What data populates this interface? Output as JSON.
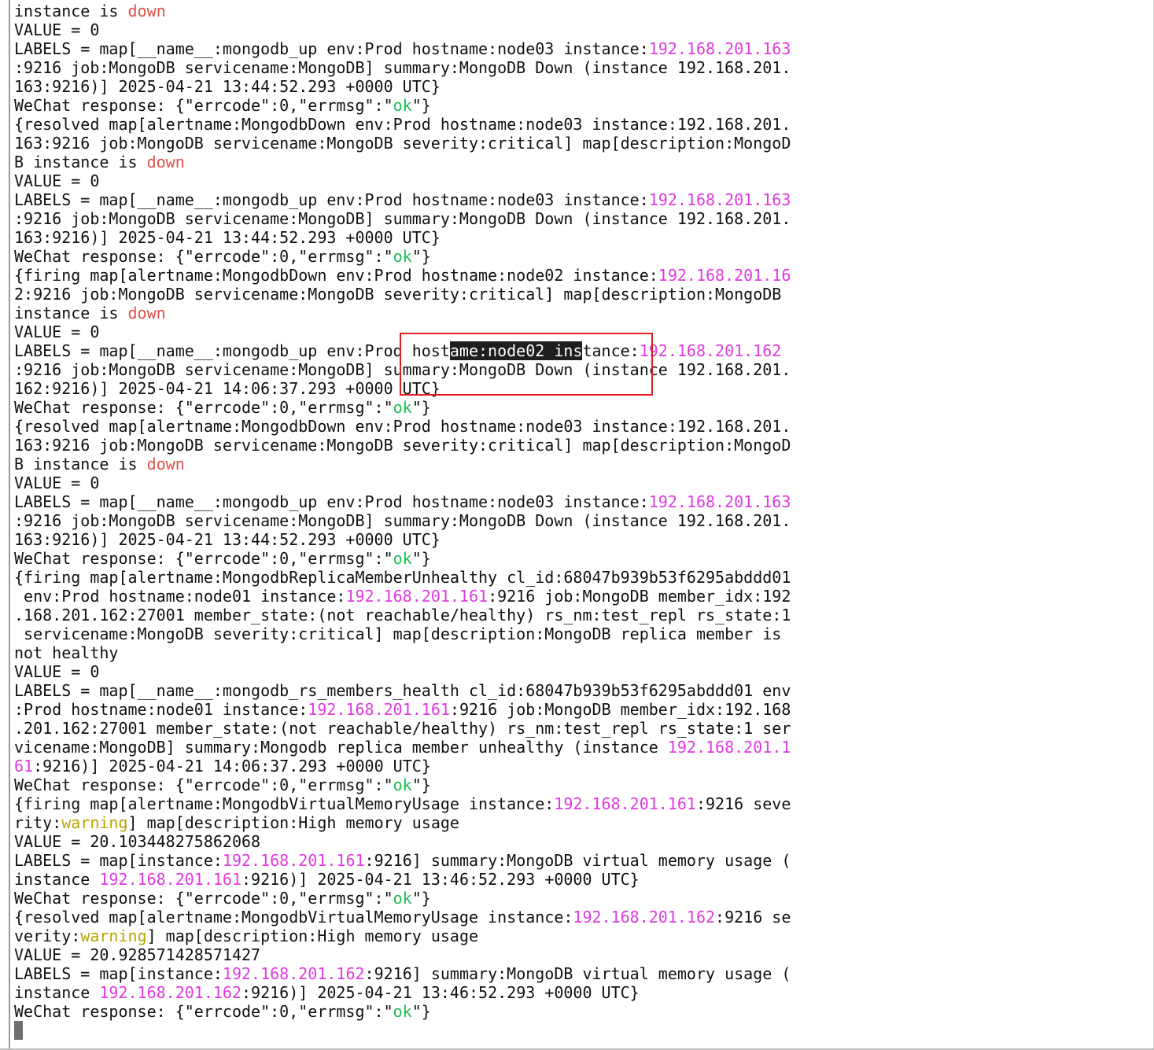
{
  "terminal": {
    "lines": [
      [
        {
          "t": "instance is ",
          "c": "default"
        },
        {
          "t": "down",
          "c": "red"
        }
      ],
      [
        {
          "t": "VALUE = 0",
          "c": "default"
        }
      ],
      [
        {
          "t": "LABELS = map[__name__:mongodb_up env:Prod hostname:node03 instance:",
          "c": "default"
        },
        {
          "t": "192.168.201.163",
          "c": "magenta"
        }
      ],
      [
        {
          "t": ":9216 job:MongoDB servicename:MongoDB] summary:MongoDB Down (instance 192.168.201.",
          "c": "default"
        }
      ],
      [
        {
          "t": "163:9216)] 2025-04-21 13:44:52.293 +0000 UTC}",
          "c": "default"
        }
      ],
      [
        {
          "t": "WeChat response: {\"errcode\":0,\"errmsg\":\"",
          "c": "default"
        },
        {
          "t": "ok",
          "c": "green"
        },
        {
          "t": "\"}",
          "c": "default"
        }
      ],
      [
        {
          "t": "{resolved map[alertname:MongodbDown env:Prod hostname:node03 instance:192.168.201.",
          "c": "default"
        }
      ],
      [
        {
          "t": "163:9216 job:MongoDB servicename:MongoDB severity:critical] map[description:MongoD",
          "c": "default"
        }
      ],
      [
        {
          "t": "B instance is ",
          "c": "default"
        },
        {
          "t": "down",
          "c": "red"
        }
      ],
      [
        {
          "t": "VALUE = 0",
          "c": "default"
        }
      ],
      [
        {
          "t": "LABELS = map[__name__:mongodb_up env:Prod hostname:node03 instance:",
          "c": "default"
        },
        {
          "t": "192.168.201.163",
          "c": "magenta"
        }
      ],
      [
        {
          "t": ":9216 job:MongoDB servicename:MongoDB] summary:MongoDB Down (instance 192.168.201.",
          "c": "default"
        }
      ],
      [
        {
          "t": "163:9216)] 2025-04-21 13:44:52.293 +0000 UTC}",
          "c": "default"
        }
      ],
      [
        {
          "t": "WeChat response: {\"errcode\":0,\"errmsg\":\"",
          "c": "default"
        },
        {
          "t": "ok",
          "c": "green"
        },
        {
          "t": "\"}",
          "c": "default"
        }
      ],
      [
        {
          "t": "{firing map[alertname:MongodbDown env:Prod hostname:node02 instance:",
          "c": "default"
        },
        {
          "t": "192.168.201.16",
          "c": "magenta"
        }
      ],
      [
        {
          "t": "2:9216 job:MongoDB servicename:MongoDB severity:critical] map[description:MongoDB",
          "c": "default"
        }
      ],
      [
        {
          "t": "instance is ",
          "c": "default"
        },
        {
          "t": "down",
          "c": "red"
        }
      ],
      [
        {
          "t": "VALUE = 0",
          "c": "default"
        }
      ],
      [
        {
          "t": "LABELS = map[__name__:mongodb_up env:Prod host",
          "c": "default"
        },
        {
          "t": "ame:node02 ins",
          "c": "selected"
        },
        {
          "t": "tance:",
          "c": "default"
        },
        {
          "t": "192.168.201.162",
          "c": "magenta"
        }
      ],
      [
        {
          "t": ":9216 job:MongoDB servicename:MongoDB] summary:MongoDB Down (instance 192.168.201.",
          "c": "default"
        }
      ],
      [
        {
          "t": "162:9216)] 2025-04-21 14:06:37.293 +0000 UTC}",
          "c": "default"
        }
      ],
      [
        {
          "t": "WeChat response: {\"errcode\":0,\"errmsg\":\"",
          "c": "default"
        },
        {
          "t": "ok",
          "c": "green"
        },
        {
          "t": "\"}",
          "c": "default"
        }
      ],
      [
        {
          "t": "{resolved map[alertname:MongodbDown env:Prod hostname:node03 instance:192.168.201.",
          "c": "default"
        }
      ],
      [
        {
          "t": "163:9216 job:MongoDB servicename:MongoDB severity:critical] map[description:MongoD",
          "c": "default"
        }
      ],
      [
        {
          "t": "B instance is ",
          "c": "default"
        },
        {
          "t": "down",
          "c": "red"
        }
      ],
      [
        {
          "t": "VALUE = 0",
          "c": "default"
        }
      ],
      [
        {
          "t": "LABELS = map[__name__:mongodb_up env:Prod hostname:node03 instance:",
          "c": "default"
        },
        {
          "t": "192.168.201.163",
          "c": "magenta"
        }
      ],
      [
        {
          "t": ":9216 job:MongoDB servicename:MongoDB] summary:MongoDB Down (instance 192.168.201.",
          "c": "default"
        }
      ],
      [
        {
          "t": "163:9216)] 2025-04-21 13:44:52.293 +0000 UTC}",
          "c": "default"
        }
      ],
      [
        {
          "t": "WeChat response: {\"errcode\":0,\"errmsg\":\"",
          "c": "default"
        },
        {
          "t": "ok",
          "c": "green"
        },
        {
          "t": "\"}",
          "c": "default"
        }
      ],
      [
        {
          "t": "{firing map[alertname:MongodbReplicaMemberUnhealthy cl_id:68047b939b53f6295abddd01",
          "c": "default"
        }
      ],
      [
        {
          "t": " env:Prod hostname:node01 instance:",
          "c": "default"
        },
        {
          "t": "192.168.201.161",
          "c": "magenta"
        },
        {
          "t": ":9216 job:MongoDB member_idx:192",
          "c": "default"
        }
      ],
      [
        {
          "t": ".168.201.162:27001 member_state:(not reachable/healthy) rs_nm:test_repl rs_state:1",
          "c": "default"
        }
      ],
      [
        {
          "t": " servicename:MongoDB severity:critical] map[description:MongoDB replica member is",
          "c": "default"
        }
      ],
      [
        {
          "t": "not healthy",
          "c": "default"
        }
      ],
      [
        {
          "t": "VALUE = 0",
          "c": "default"
        }
      ],
      [
        {
          "t": "LABELS = map[__name__:mongodb_rs_members_health cl_id:68047b939b53f6295abddd01 env",
          "c": "default"
        }
      ],
      [
        {
          "t": ":Prod hostname:node01 instance:",
          "c": "default"
        },
        {
          "t": "192.168.201.161",
          "c": "magenta"
        },
        {
          "t": ":9216 job:MongoDB member_idx:192.168",
          "c": "default"
        }
      ],
      [
        {
          "t": ".201.162:27001 member_state:(not reachable/healthy) rs_nm:test_repl rs_state:1 ser",
          "c": "default"
        }
      ],
      [
        {
          "t": "vicename:MongoDB] summary:Mongodb replica member unhealthy (instance ",
          "c": "default"
        },
        {
          "t": "192.168.201.1",
          "c": "magenta"
        }
      ],
      [
        {
          "t": "61",
          "c": "magenta"
        },
        {
          "t": ":9216)] 2025-04-21 14:06:37.293 +0000 UTC}",
          "c": "default"
        }
      ],
      [
        {
          "t": "WeChat response: {\"errcode\":0,\"errmsg\":\"",
          "c": "default"
        },
        {
          "t": "ok",
          "c": "green"
        },
        {
          "t": "\"}",
          "c": "default"
        }
      ],
      [
        {
          "t": "{firing map[alertname:MongodbVirtualMemoryUsage instance:",
          "c": "default"
        },
        {
          "t": "192.168.201.161",
          "c": "magenta"
        },
        {
          "t": ":9216 seve",
          "c": "default"
        }
      ],
      [
        {
          "t": "rity:",
          "c": "default"
        },
        {
          "t": "warning",
          "c": "yellow"
        },
        {
          "t": "] map[description:High memory usage",
          "c": "default"
        }
      ],
      [
        {
          "t": "VALUE = 20.103448275862068",
          "c": "default"
        }
      ],
      [
        {
          "t": "LABELS = map[instance:",
          "c": "default"
        },
        {
          "t": "192.168.201.161",
          "c": "magenta"
        },
        {
          "t": ":9216] summary:MongoDB virtual memory usage (",
          "c": "default"
        }
      ],
      [
        {
          "t": "instance ",
          "c": "default"
        },
        {
          "t": "192.168.201.161",
          "c": "magenta"
        },
        {
          "t": ":9216)] 2025-04-21 13:46:52.293 +0000 UTC}",
          "c": "default"
        }
      ],
      [
        {
          "t": "WeChat response: {\"errcode\":0,\"errmsg\":\"",
          "c": "default"
        },
        {
          "t": "ok",
          "c": "green"
        },
        {
          "t": "\"}",
          "c": "default"
        }
      ],
      [
        {
          "t": "{resolved map[alertname:MongodbVirtualMemoryUsage instance:",
          "c": "default"
        },
        {
          "t": "192.168.201.162",
          "c": "magenta"
        },
        {
          "t": ":9216 se",
          "c": "default"
        }
      ],
      [
        {
          "t": "verity:",
          "c": "default"
        },
        {
          "t": "warning",
          "c": "yellow"
        },
        {
          "t": "] map[description:High memory usage",
          "c": "default"
        }
      ],
      [
        {
          "t": "VALUE = 20.928571428571427",
          "c": "default"
        }
      ],
      [
        {
          "t": "LABELS = map[instance:",
          "c": "default"
        },
        {
          "t": "192.168.201.162",
          "c": "magenta"
        },
        {
          "t": ":9216] summary:MongoDB virtual memory usage (",
          "c": "default"
        }
      ],
      [
        {
          "t": "instance ",
          "c": "default"
        },
        {
          "t": "192.168.201.162",
          "c": "magenta"
        },
        {
          "t": ":9216)] 2025-04-21 13:46:52.293 +0000 UTC}",
          "c": "default"
        }
      ],
      [
        {
          "t": "WeChat response: {\"errcode\":0,\"errmsg\":\"",
          "c": "default"
        },
        {
          "t": "ok",
          "c": "green"
        },
        {
          "t": "\"}",
          "c": "default"
        }
      ]
    ],
    "colors": {
      "background": "#ffffff",
      "default": "#111111",
      "red": "#e0504c",
      "magenta": "#e03adf",
      "green": "#1fbf55",
      "yellow": "#b8a600",
      "selection_background": "#1e1e1e",
      "annotation_box": "#e02020",
      "cursor": "#6f6f6f"
    }
  }
}
